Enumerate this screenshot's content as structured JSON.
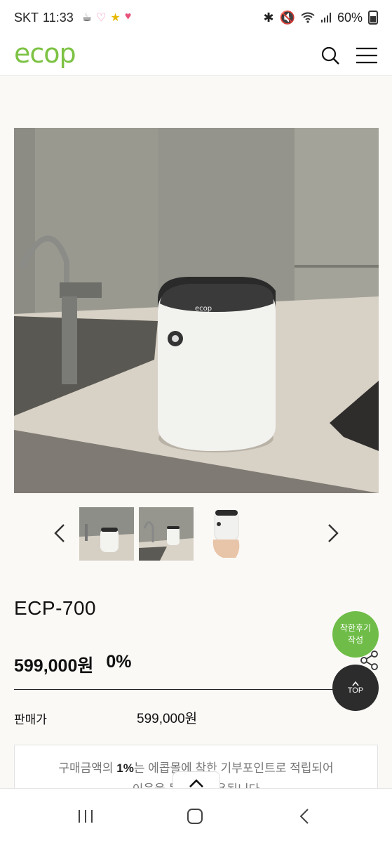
{
  "status_bar": {
    "carrier": "SKT",
    "time": "11:33",
    "battery": "60%"
  },
  "header": {
    "logo": "ecop"
  },
  "product": {
    "name": "ECP-700",
    "price": "599,000원",
    "discount": "0%",
    "sale_label": "판매가",
    "sale_value": "599,000원"
  },
  "notice": {
    "line1_pre": "구매금액의 ",
    "line1_bold": "1%",
    "line1_post": "는 에콥몰에 착한 기부포인트로 적립되어",
    "line2": "이웃을 돕는데 사용됩니다"
  },
  "floating": {
    "review_line1": "착한후기",
    "review_line2": "작성",
    "top_label": "TOP"
  },
  "colors": {
    "brand_green": "#7cc243",
    "review_green": "#6fbd48",
    "top_dark": "#2c2c2c"
  }
}
